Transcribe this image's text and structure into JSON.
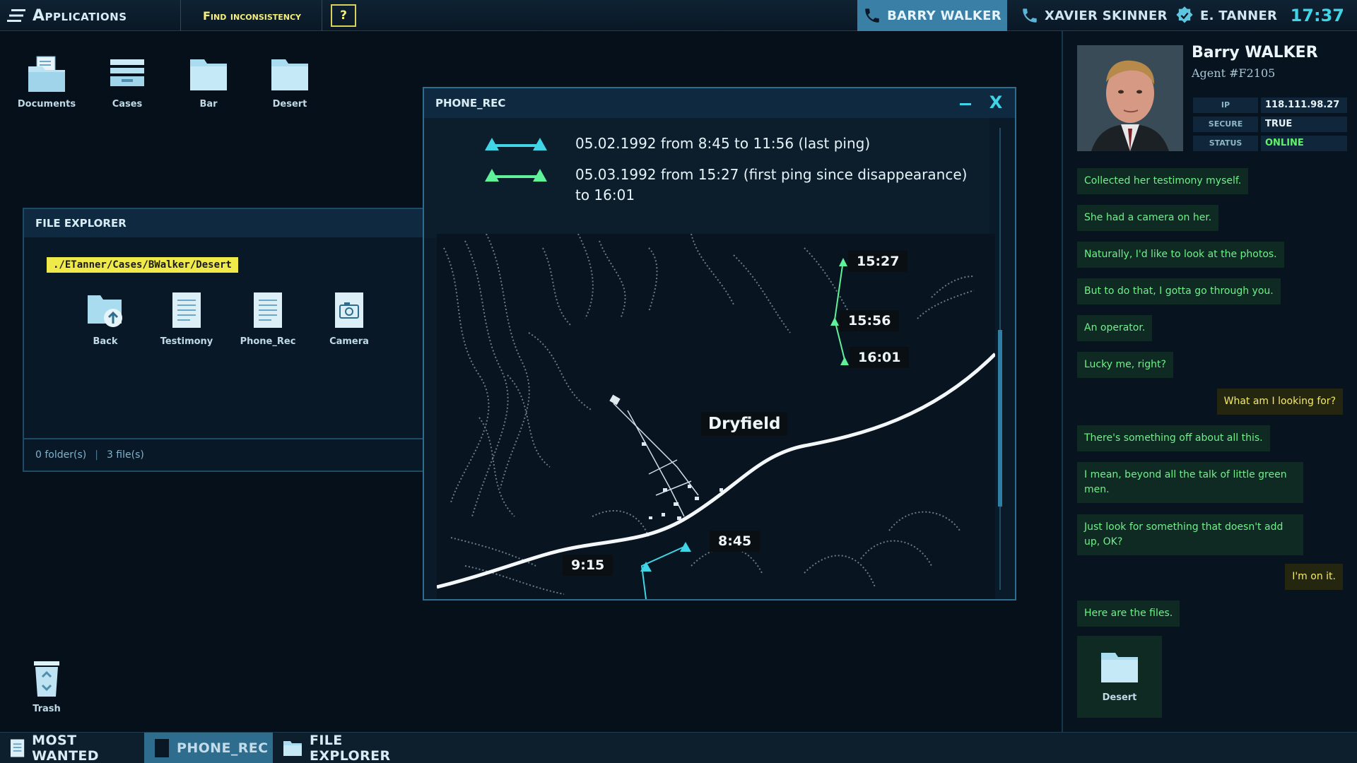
{
  "topbar": {
    "apps_label": "Applications",
    "find_label": "Find inconsistency",
    "help_label": "?",
    "contacts": [
      {
        "name": "BARRY WALKER",
        "icon": "phone-icon",
        "active": true
      },
      {
        "name": "XAVIER SKINNER",
        "icon": "phone-icon",
        "active": false
      },
      {
        "name": "E. TANNER",
        "icon": "badge-icon",
        "active": false
      }
    ],
    "clock": "17:37",
    "accent": "#3fd5e6"
  },
  "desktop": {
    "icons": [
      {
        "label": "Documents",
        "icon": "documents-folder-icon"
      },
      {
        "label": "Cases",
        "icon": "cases-icon"
      },
      {
        "label": "Bar",
        "icon": "folder-icon"
      },
      {
        "label": "Desert",
        "icon": "folder-icon"
      }
    ],
    "trash_label": "Trash"
  },
  "file_explorer": {
    "title": "FILE EXPLORER",
    "path": "./ETanner/Cases/BWalker/Desert",
    "items": [
      {
        "label": "Back",
        "icon": "folder-back-icon"
      },
      {
        "label": "Testimony",
        "icon": "document-icon"
      },
      {
        "label": "Phone_Rec",
        "icon": "document-icon"
      },
      {
        "label": "Camera",
        "icon": "camera-file-icon"
      }
    ],
    "folders_count": "0 folder(s)",
    "files_count": "3 file(s)"
  },
  "phone_rec": {
    "title": "PHONE_REC",
    "close_label": "X",
    "legend": [
      {
        "text": "05.02.1992 from 8:45 to 11:56 (last ping)",
        "color": "#3fd5e6"
      },
      {
        "text": "05.03.1992 from 15:27 (first ping since disappearance) to 16:01",
        "color": "#5ff29a"
      }
    ],
    "map": {
      "town": "Dryfield",
      "pings": [
        "15:27",
        "15:56",
        "16:01",
        "8:45",
        "9:15"
      ]
    }
  },
  "profile": {
    "name": "Barry WALKER",
    "agent_id": "Agent #F2105",
    "stats": [
      {
        "key": "IP",
        "value": "118.111.98.27"
      },
      {
        "key": "SECURE",
        "value": "TRUE"
      },
      {
        "key": "STATUS",
        "value": "ONLINE"
      }
    ]
  },
  "chat": {
    "messages": [
      {
        "from": "in",
        "text": "Collected her testimony myself."
      },
      {
        "from": "in",
        "text": "She had a camera on her."
      },
      {
        "from": "in",
        "text": "Naturally, I'd like to look at the photos."
      },
      {
        "from": "in",
        "text": "But to do that, I gotta go through you."
      },
      {
        "from": "in",
        "text": "An operator."
      },
      {
        "from": "in",
        "text": "Lucky me, right?"
      },
      {
        "from": "out",
        "text": "What am I looking for?"
      },
      {
        "from": "in",
        "text": "There's something off about all this."
      },
      {
        "from": "in",
        "text": "I mean, beyond all the talk of little green men."
      },
      {
        "from": "in",
        "text": "Just look for something that doesn't add up, OK?"
      },
      {
        "from": "out",
        "text": "I'm on it."
      },
      {
        "from": "in",
        "text": "Here are the files."
      }
    ],
    "shared_folder_label": "Desert"
  },
  "taskbar": {
    "items": [
      {
        "label": "MOST WANTED",
        "icon": "document-icon"
      },
      {
        "label": "PHONE_REC",
        "icon": "phone-window-icon"
      },
      {
        "label": "FILE EXPLORER",
        "icon": "folder-icon"
      }
    ]
  }
}
